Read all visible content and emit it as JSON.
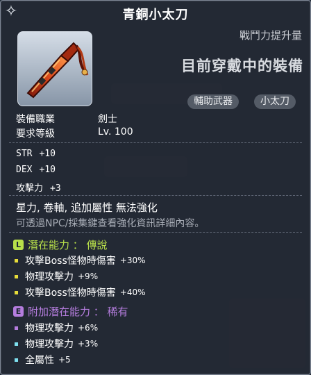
{
  "colors": {
    "legendary": "#b8e04a",
    "epic": "#b57dde",
    "bonus_dot": "#7fe1f0",
    "main_dot": "#e6dc3a"
  },
  "header": {
    "item_name": "青銅小太刀",
    "close_icon": "wing-cursor-icon"
  },
  "item": {
    "icon": "short-blade-weapon-icon",
    "power_up_label": "戰鬥力提升量",
    "equipped_label": "目前穿戴中的裝備",
    "tags": [
      "輔助武器",
      "小太刀"
    ]
  },
  "requirements": {
    "job_label": "裝備職業",
    "job_value": "劍士",
    "level_label": "要求等級",
    "level_value": "Lv. 100"
  },
  "stats": [
    {
      "name": "STR",
      "value": "+10"
    },
    {
      "name": "DEX",
      "value": "+10"
    },
    {
      "name": "攻擊力",
      "value": "+3"
    }
  ],
  "info": {
    "flags": "星力, 卷軸, 追加屬性 無法強化",
    "hint": "可透過NPC/採集鍵查看強化資訊詳細內容。"
  },
  "potential": {
    "badge": "L",
    "title": "潛在能力 ： 傳說",
    "lines": [
      {
        "label": "攻擊Boss怪物時傷害",
        "value": "+30%"
      },
      {
        "label": "物理攻擊力",
        "value": "+9%"
      },
      {
        "label": "攻擊Boss怪物時傷害",
        "value": "+40%"
      }
    ]
  },
  "bonus_potential": {
    "badge": "E",
    "title": "附加潛在能力 ： 稀有",
    "lines": [
      {
        "label": "物理攻擊力",
        "value": "+6%"
      },
      {
        "label": "物理攻擊力",
        "value": "+3%"
      },
      {
        "label": "全屬性",
        "value": "+5"
      }
    ]
  }
}
